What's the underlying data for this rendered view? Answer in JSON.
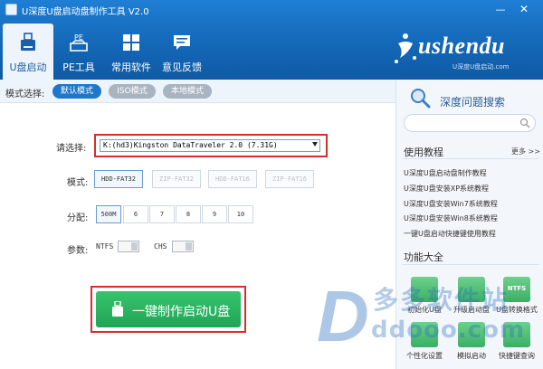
{
  "window": {
    "title": "U深度U盘启动盘制作工具 V2.0",
    "minimize_glyph": "—",
    "close_glyph": "✕"
  },
  "nav": {
    "items": [
      {
        "label": "U盘启动",
        "icon": "usb-drive-icon",
        "active": true
      },
      {
        "label": "PE工具",
        "icon": "pe-tool-icon",
        "icon_text": "PE",
        "active": false
      },
      {
        "label": "常用软件",
        "icon": "apps-grid-icon",
        "active": false
      },
      {
        "label": "意见反馈",
        "icon": "feedback-chat-icon",
        "active": false
      }
    ]
  },
  "logo": {
    "text": "ushendu",
    "tagline": "U深度U盘启动.com"
  },
  "mode_bar": {
    "label": "模式选择:",
    "modes": [
      {
        "label": "默认模式",
        "active": true
      },
      {
        "label": "ISO模式",
        "active": false
      },
      {
        "label": "本地模式",
        "active": false
      }
    ]
  },
  "main": {
    "select_label": "请选择:",
    "selected_drive": "K:(hd3)Kingston DataTraveler 2.0 (7.31G)",
    "mode_label": "模式:",
    "formats": [
      {
        "label": "HDD-FAT32",
        "active": true
      },
      {
        "label": "ZIP-FAT32",
        "active": false
      },
      {
        "label": "HDD-FAT16",
        "active": false
      },
      {
        "label": "ZIP-FAT16",
        "active": false
      }
    ],
    "partition_label": "分配:",
    "sizes": [
      {
        "label": "500M",
        "active": true
      },
      {
        "label": "6",
        "active": false
      },
      {
        "label": "7",
        "active": false
      },
      {
        "label": "8",
        "active": false
      },
      {
        "label": "9",
        "active": false
      },
      {
        "label": "10",
        "active": false
      }
    ],
    "params_label": "参数:",
    "params": [
      {
        "name": "NTFS",
        "on": false
      },
      {
        "name": "CHS",
        "on": false
      }
    ],
    "make_button": "一键制作启动U盘"
  },
  "sidebar": {
    "search_title": "深度问题搜索",
    "search_placeholder": "",
    "tutorials_title": "使用教程",
    "more_link": "更多 >>",
    "tutorials": [
      "U深度U盘启动盘制作教程",
      "U深度U盘安装XP系统教程",
      "U深度U盘安装Win7系统教程",
      "U深度U盘安装Win8系统教程",
      "一键U盘启动快捷键使用教程"
    ],
    "functions_title": "功能大全",
    "functions": [
      {
        "label": "初始化U盘",
        "icon": "init-usb-icon"
      },
      {
        "label": "升级启动盘",
        "icon": "upgrade-icon"
      },
      {
        "label": "U盘转换格式",
        "icon": "ntfs-convert-icon",
        "icon_text": "NTFS"
      },
      {
        "label": "个性化设置",
        "icon": "personalize-icon"
      },
      {
        "label": "模拟启动",
        "icon": "simulate-boot-icon"
      },
      {
        "label": "快捷键查询",
        "icon": "shortcut-query-icon"
      }
    ]
  },
  "watermark": {
    "letter": "D",
    "name": "多多软件站",
    "url": "ddooo.com"
  },
  "colors": {
    "header_blue": "#1468b8",
    "accent_blue": "#1f77c9",
    "make_green": "#1fa656",
    "highlight_red": "#d32f2f"
  }
}
